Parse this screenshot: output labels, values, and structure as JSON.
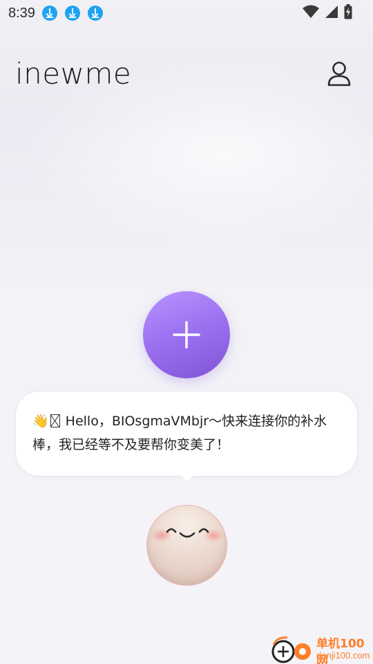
{
  "status_bar": {
    "time": "8:39",
    "notifications": [
      "download-icon",
      "download-icon",
      "download-icon"
    ],
    "indicators": [
      "wifi-icon",
      "signal-icon",
      "battery-charging-icon"
    ]
  },
  "header": {
    "logo": "inewme",
    "profile_icon": "person-icon"
  },
  "main": {
    "add_button_icon": "plus-icon",
    "bubble": {
      "emoji": "👋",
      "message": "Hello，BIOsgmaVMbjr～快来连接你的补水棒，我已经等不及要帮你变美了！"
    },
    "avatar": "smiling-face-avatar"
  },
  "watermark": {
    "title": "单机100网",
    "url": "danji100.com"
  },
  "colors": {
    "accent": "#9a6ff0",
    "download_badge": "#1fa3f0",
    "watermark": "#ff7f2a"
  }
}
